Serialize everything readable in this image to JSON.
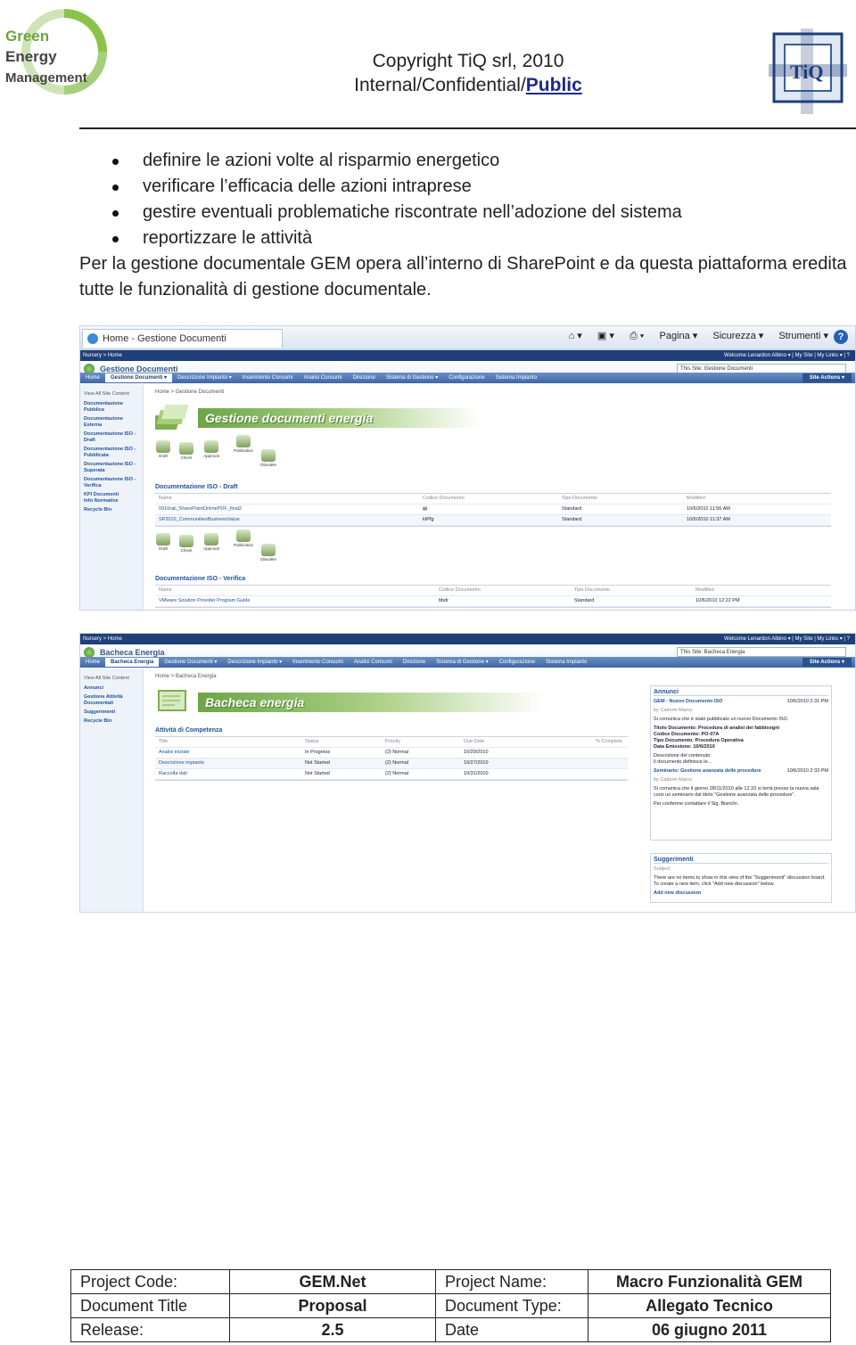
{
  "header": {
    "logo": {
      "line1": "Green",
      "line2": "Energy",
      "line3": "Management"
    },
    "copyright": "Copyright TiQ srl, 2010",
    "classification_prefix": "Internal/Confidential/",
    "classification_strong": "Public",
    "right_logo_text": "TiQ"
  },
  "bullets": [
    "definire le azioni volte al risparmio energetico",
    "verificare l’efficacia delle azioni intraprese",
    "gestire eventuali problematiche riscontrate nell’adozione del sistema",
    "reportizzare le attività"
  ],
  "paragraph": "Per la gestione documentale GEM opera all’interno di SharePoint e da questa piattaforma eredita tutte le funzionalità di gestione documentale.",
  "screenshot1": {
    "browser_tab": "Home - Gestione Documenti",
    "browser_cmds": [
      "Pagina ▾",
      "Sicurezza ▾",
      "Strumenti ▾"
    ],
    "browser_help": "?",
    "top_left": "Nursery > Home",
    "top_right": "Welcome Lenardon Albino ▾  |  My Site  |  My Links ▾  |  ?",
    "site_title": "Gestione Documenti",
    "search": "This Site: Gestione Documenti",
    "nav": [
      "Home",
      "Gestione Documenti ▾",
      "Descrizione Impianto ▾",
      "Inserimento Consumi",
      "Analisi Consumi",
      "Direzione",
      "Sistema di Gestione ▾",
      "Configurazione",
      "Sistema Impianto"
    ],
    "site_actions": "Site Actions ▾",
    "left_nav": {
      "view_all": "View All Site Content",
      "items": [
        "Documentazione Pubblica",
        "Documentazione Esterna",
        "Documentazione ISO - Draft",
        "Documentazione ISO - Pubblicata",
        "Documentazione ISO - Superata",
        "Documentazione ISO - Verifica",
        "KPI Documenti",
        "Info Normative"
      ],
      "recycle": "Recycle Bin"
    },
    "breadcrumb": "Home > Gestione Documenti",
    "banner": "Gestione documenti energia",
    "workflow": [
      "Draft",
      "Check",
      "Approval",
      "Publication",
      "Obsolete"
    ],
    "list1": {
      "title": "Documentazione ISO - Draft",
      "headers": [
        "Name",
        "Codice Documento",
        "Tipo Documento",
        "Modified"
      ],
      "rows": [
        [
          "0910rail_SharePointOnlinePDF_final2",
          "",
          "Standard",
          "10/6/2010 11:56 AM"
        ],
        [
          "SP2010_CommunitiesBusinessValue",
          "ktPfg",
          "Standard",
          "10/6/2010 11:37 AM"
        ]
      ]
    },
    "list2": {
      "title": "Documentazione ISO - Verifica",
      "headers": [
        "Name",
        "Codice Documento",
        "Tipo Documento",
        "Modified"
      ],
      "rows": [
        [
          "VMware Solution Provider Program Guide",
          "bbdr",
          "Standard",
          "10/6/2010 12:22 PM"
        ]
      ]
    }
  },
  "screenshot2": {
    "top_left": "Nursery > Home",
    "top_right": "Welcome Lenardon Albino ▾  |  My Site  |  My Links ▾  |  ?",
    "site_title": "Bacheca Energia",
    "search": "This Site: Bacheca Energia",
    "nav": [
      "Home",
      "Bacheca Energia",
      "Gestione Documenti ▾",
      "Descrizione Impianto ▾",
      "Inserimento Consumi",
      "Analisi Consumi",
      "Direzione",
      "Sistema di Gestione ▾",
      "Configurazione",
      "Sistema Impianto"
    ],
    "site_actions": "Site Actions ▾",
    "left_nav": {
      "view_all": "View All Site Content",
      "items": [
        "Annunci",
        "Gestione Attività Documentali",
        "Suggerimenti"
      ],
      "recycle": "Recycle Bin"
    },
    "breadcrumb": "Home > Bacheca Energia",
    "banner": "Bacheca energia",
    "tasks": {
      "title": "Attività di Competenza",
      "headers": [
        "Title",
        "Status",
        "Priority",
        "Due Date",
        "% Complete"
      ],
      "rows": [
        [
          "Analisi iniziale",
          "In Progress",
          "(2) Normal",
          "10/20/2010",
          ""
        ],
        [
          "Descrizione impianto",
          "Not Started",
          "(2) Normal",
          "10/27/2010",
          ""
        ],
        [
          "Raccolta dati",
          "Not Started",
          "(2) Normal",
          "10/31/2010",
          ""
        ]
      ]
    },
    "annunci": {
      "title": "Annunci",
      "item1_title": "GEM - Nuovo Documento ISO",
      "item1_date": "10/6/2010 2:31 PM",
      "item1_by": "by Cadorin Marco",
      "item1_text": "Si comunica che è stato pubblicato un nuovo Documento ISO.",
      "item1_details": [
        "Titolo Documento: Procedura di analisi dei fabbisogni",
        "Codice Documento: PO-07A",
        "Tipo Documento: Procedura Operativa",
        "Data Emissione: 10/6/2010"
      ],
      "item1_desc": "Descrizione del contenuto:",
      "item1_desc2": "Il documento definisce le...",
      "item2_title": "Seminario: Gestione avanzata delle procedure",
      "item2_date": "10/6/2010 2:33 PM",
      "item2_by": "by Cadorin Marco",
      "item2_text": "Si comunica che il giorno 28/11/2010 alle 12.33 si terrà presso la nuova sala corsi un seminario dal titolo \"Gestione avanzata delle procedure\".",
      "item2_contact": "Per conferme contattare il Sig. Bianchi."
    },
    "suggerimenti": {
      "title": "Suggerimenti",
      "col": "Subject",
      "empty": "There are no items to show in this view of the \"Suggerimenti\" discussion board. To create a new item, click \"Add new discussion\" below.",
      "add": "Add new discussion"
    }
  },
  "footer": {
    "rows": [
      [
        "Project Code:",
        "GEM.Net",
        "Project Name:",
        "Macro Funzionalità GEM"
      ],
      [
        "Document Title",
        "Proposal",
        "Document Type:",
        "Allegato Tecnico"
      ],
      [
        "Release:",
        "2.5",
        "Date",
        "06 giugno 2011"
      ]
    ]
  },
  "colors": {
    "sharepoint_blue": "#1f3f78",
    "banner_green": "#6da547",
    "logo_green": "#7cb342"
  }
}
